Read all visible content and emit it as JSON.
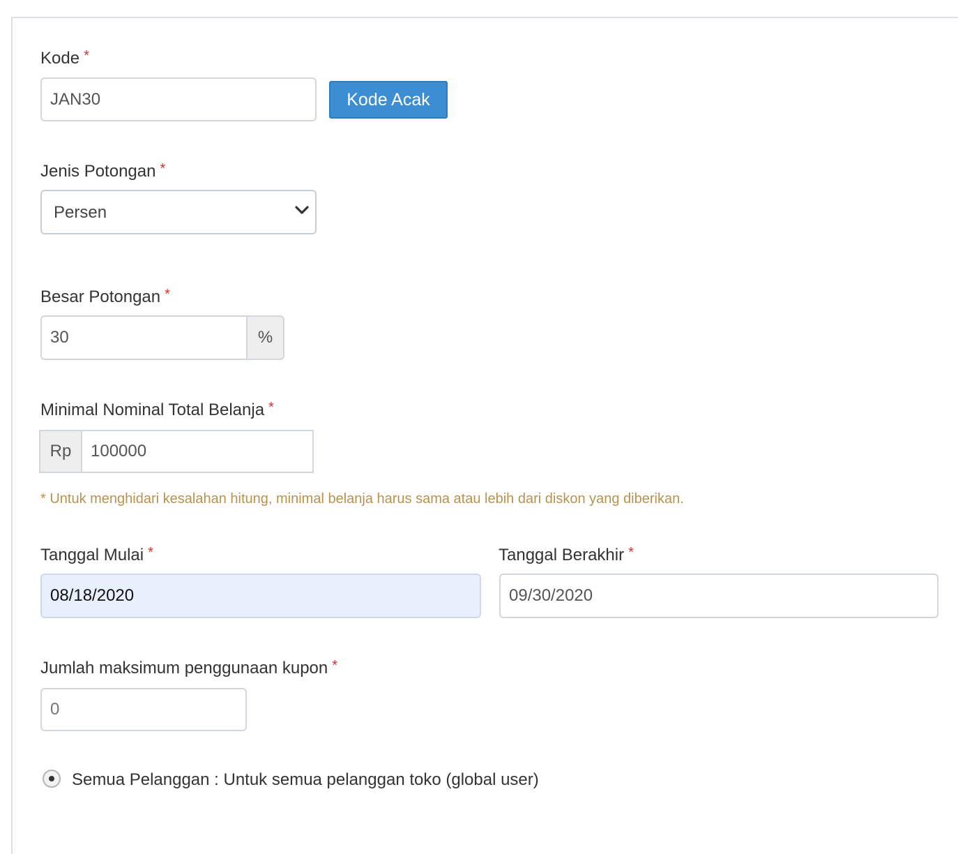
{
  "form": {
    "kode": {
      "label": "Kode",
      "required": "*",
      "value": "JAN30",
      "random_button": "Kode Acak"
    },
    "jenis_potongan": {
      "label": "Jenis Potongan",
      "required": "*",
      "selected": "Persen"
    },
    "besar_potongan": {
      "label": "Besar Potongan",
      "required": "*",
      "value": "30",
      "suffix": "%"
    },
    "minimal_belanja": {
      "label": "Minimal Nominal Total Belanja",
      "required": "*",
      "prefix": "Rp",
      "value": "100000",
      "help": "* Untuk menghidari kesalahan hitung, minimal belanja harus sama atau lebih dari diskon yang diberikan."
    },
    "tanggal_mulai": {
      "label": "Tanggal Mulai",
      "required": "*",
      "value": "08/18/2020"
    },
    "tanggal_berakhir": {
      "label": "Tanggal Berakhir",
      "required": "*",
      "value": "09/30/2020"
    },
    "max_penggunaan": {
      "label": "Jumlah maksimum penggunaan kupon",
      "required": "*",
      "placeholder": "0"
    },
    "pelanggan": {
      "option_all": "Semua Pelanggan : Untuk semua pelanggan toko (global user)",
      "option_all_selected": true
    }
  },
  "colors": {
    "primary": "#3c8dd2",
    "required": "#d9302c",
    "help_text": "#b8924a",
    "date_highlight": "#e8f0fe"
  }
}
